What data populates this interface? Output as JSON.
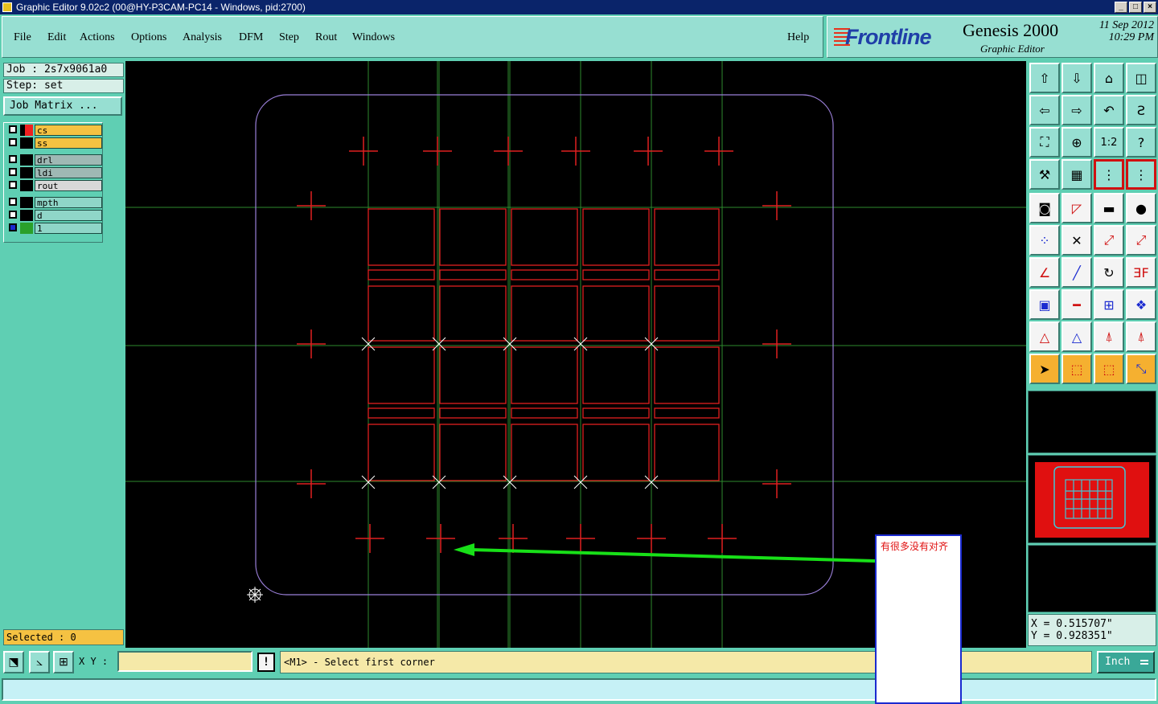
{
  "window": {
    "title": "Graphic Editor 9.02c2 (00@HY-P3CAM-PC14 - Windows, pid:2700)",
    "controls": [
      "_",
      "□",
      "×"
    ]
  },
  "menu": {
    "items": [
      "File",
      "Edit",
      "Actions",
      "Options",
      "Analysis",
      "DFM",
      "Step",
      "Rout",
      "Windows"
    ],
    "help": "Help"
  },
  "logo": {
    "brand": "Frontline",
    "product": "Genesis 2000",
    "subtitle": "Graphic Editor",
    "date": "11 Sep 2012",
    "time": "10:29 PM"
  },
  "job": {
    "label": "Job : 2s7x9061a0",
    "step": "Step: set",
    "matrix_button": "Job Matrix ..."
  },
  "layers": [
    {
      "name": "cs",
      "color": "#f02020",
      "bg": "#f5c242"
    },
    {
      "name": "ss",
      "color": "#000000",
      "bg": "#f5c242"
    },
    {
      "name": "drl",
      "color": "#000000",
      "bg": "#9fb8b4"
    },
    {
      "name": "ldi",
      "color": "#000000",
      "bg": "#9fb8b4"
    },
    {
      "name": "rout",
      "color": "#000000",
      "bg": "#d8d8d8"
    },
    {
      "name": "mpth",
      "color": "#000000",
      "bg": "#8fd6c8"
    },
    {
      "name": "d",
      "color": "#000000",
      "bg": "#8fd6c8"
    },
    {
      "name": "1",
      "color": "#2aa02a",
      "bg": "#8fd6c8"
    }
  ],
  "selected": "Selected : 0",
  "status": {
    "xy_label": "X Y :",
    "xy_value": "",
    "bang": "!",
    "prompt": "<M1> - Select first corner",
    "unit": "Inch"
  },
  "coords": {
    "x": "X = 0.515707\"",
    "y": "Y = 0.928351\""
  },
  "note": {
    "text": "有很多没有对齐"
  },
  "colors": {
    "outline": "#9a7fd8",
    "panel_lines": "#e02020",
    "guides": "#2e8a2e",
    "arrow": "#18e018",
    "accent": "#5fcfb3"
  },
  "tools": [
    "upload-icon",
    "download-icon",
    "home-icon",
    "window-icon",
    "left-arrow-icon",
    "right-arrow-icon",
    "back-icon",
    "zigzag-icon",
    "fit-icon",
    "zoom-icon",
    "ratio-icon",
    "help-icon",
    "wrench-icon",
    "grid-icon",
    "layers-red-icon",
    "layers-blue-icon",
    "pad-icon",
    "edit-shape-icon",
    "ruler-icon",
    "dot-icon",
    "connect-icon",
    "cross-icon",
    "move-icon",
    "move2-icon",
    "angle-icon",
    "line-icon",
    "rotate-icon",
    "mirror-icon",
    "pad-move-icon",
    "line-minus-icon",
    "measure-icon",
    "group-icon",
    "triangle-icon",
    "triangle2-icon",
    "triangle3-icon",
    "triangle4-icon",
    "pointer-icon",
    "select-icon",
    "select2-icon",
    "route-icon"
  ]
}
